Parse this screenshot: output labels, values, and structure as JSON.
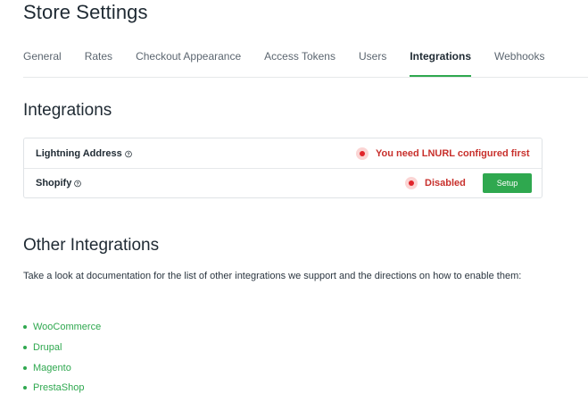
{
  "page": {
    "title": "Store Settings"
  },
  "tabs": [
    {
      "label": "General",
      "active": false
    },
    {
      "label": "Rates",
      "active": false
    },
    {
      "label": "Checkout Appearance",
      "active": false
    },
    {
      "label": "Access Tokens",
      "active": false
    },
    {
      "label": "Users",
      "active": false
    },
    {
      "label": "Integrations",
      "active": true
    },
    {
      "label": "Webhooks",
      "active": false
    }
  ],
  "integrations": {
    "title": "Integrations",
    "rows": [
      {
        "label": "Lightning Address",
        "help_icon": "question-circle-icon",
        "status_icon": "status-dot-icon",
        "status": "You need LNURL configured first"
      },
      {
        "label": "Shopify",
        "help_icon": "question-circle-icon",
        "status_icon": "status-dot-icon",
        "status": "Disabled",
        "button_label": "Setup"
      }
    ]
  },
  "other_integrations": {
    "title": "Other Integrations",
    "description": "Take a look at documentation for the list of other integrations we support and the directions on how to enable them:",
    "links": [
      {
        "label": "WooCommerce"
      },
      {
        "label": "Drupal"
      },
      {
        "label": "Magento"
      },
      {
        "label": "PrestaShop"
      }
    ]
  },
  "colors": {
    "accent": "#2fa84f",
    "error": "#c8302c",
    "error_dot": "#e0242a",
    "error_halo": "#fbd5d4",
    "border": "#dfe3e6",
    "text": "#1f2a33",
    "muted_text": "#5c6670"
  }
}
